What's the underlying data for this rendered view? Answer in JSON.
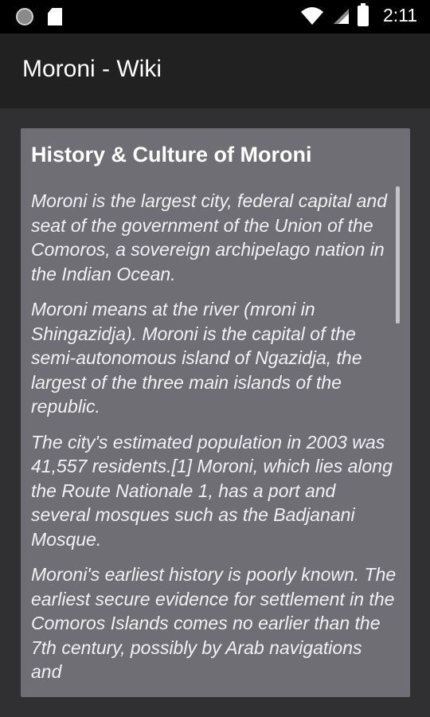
{
  "status_bar": {
    "time": "2:11",
    "icons": [
      "record-icon",
      "sd-card-icon",
      "wifi-icon",
      "signal-icon",
      "battery-icon"
    ]
  },
  "app_bar": {
    "title": "Moroni - Wiki"
  },
  "card": {
    "title": "History & Culture of Moroni",
    "paragraphs": [
      "Moroni is the largest city, federal capital and seat of the government of the Union of the Comoros, a sovereign archipelago nation in the Indian Ocean.",
      "Moroni means at the river (mroni in Shingazidja). Moroni is the capital of the semi-autonomous island of Ngazidja, the largest of the three main islands of the republic.",
      "The city's estimated population in 2003 was 41,557 residents.[1] Moroni, which lies along the Route Nationale 1, has a port and several mosques such as the Badjanani Mosque.",
      "Moroni's earliest history is poorly known. The earliest secure evidence for settlement in the Comoros Islands comes no earlier than the 7th century, possibly by Arab navigations and"
    ]
  },
  "colors": {
    "status_bar_bg": "#000000",
    "app_bar_bg": "#212121",
    "page_bg": "#302f31",
    "card_bg": "#6e6e74",
    "text": "#ffffff"
  }
}
